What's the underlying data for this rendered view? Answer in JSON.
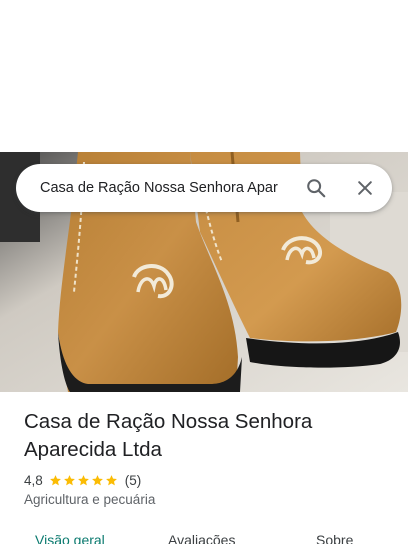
{
  "search": {
    "value": "Casa de Ração Nossa Senhora Apar",
    "search_icon": "search-icon",
    "clear_icon": "close-icon"
  },
  "place": {
    "photo": "boots-photo",
    "name": "Casa de Ração Nossa Senhora Aparecida Ltda",
    "rating": "4,8",
    "stars": 5,
    "review_count": "(5)",
    "category": "Agricultura e pecuária"
  },
  "tabs": [
    {
      "label": "Visão geral",
      "active": true
    },
    {
      "label": "Avaliações",
      "active": false
    },
    {
      "label": "Sobre",
      "active": false
    }
  ],
  "colors": {
    "star": "#fbbc04",
    "active_tab": "#0b7a6f",
    "leather": "#c08a3e"
  }
}
